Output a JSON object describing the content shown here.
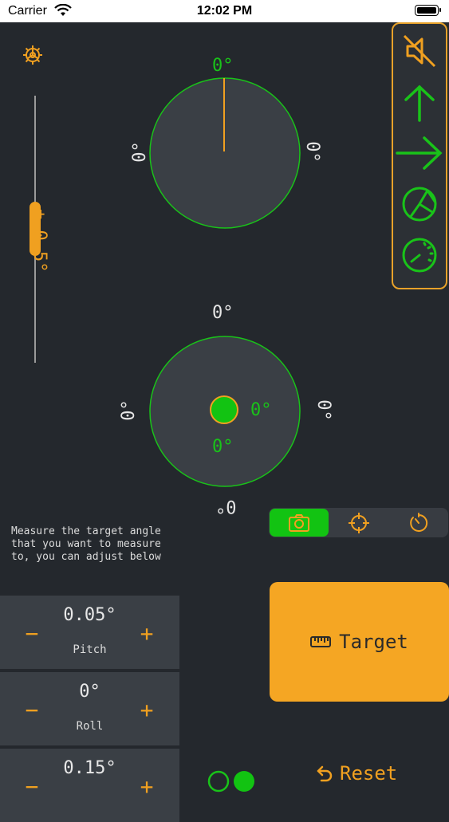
{
  "status_bar": {
    "carrier": "Carrier",
    "time": "12:02 PM"
  },
  "compass": {
    "top": "0°",
    "left": "0°",
    "right": "0°"
  },
  "level": {
    "top": "0°",
    "left": "0°",
    "right": "0°",
    "bottom": "0°",
    "x_reading": "0°",
    "y_reading": "0°"
  },
  "slider": {
    "label": "± 0.5°"
  },
  "toolbar": {
    "icons": [
      "mute-icon",
      "arrow-up-icon",
      "arrow-right-icon",
      "pie-chart-icon",
      "speedometer-icon"
    ]
  },
  "segments": {
    "icons": [
      "camera-icon",
      "crosshair-icon",
      "timer-icon"
    ],
    "selected": 0
  },
  "instruction": "Measure the target angle\nthat you want to measure\nto, you can adjust below",
  "steppers": [
    {
      "value": "0.05°",
      "label": "Pitch",
      "minus": "−",
      "plus": "+"
    },
    {
      "value": "0°",
      "label": "Roll",
      "minus": "−",
      "plus": "+"
    },
    {
      "value": "0.15°",
      "label": "",
      "minus": "−",
      "plus": "+"
    }
  ],
  "target_button": {
    "label": "Target"
  },
  "reset_button": {
    "label": "Reset"
  },
  "colors": {
    "accent": "#f5a623",
    "green": "#19c319",
    "background": "#24282d",
    "panel": "#3a3f45"
  }
}
